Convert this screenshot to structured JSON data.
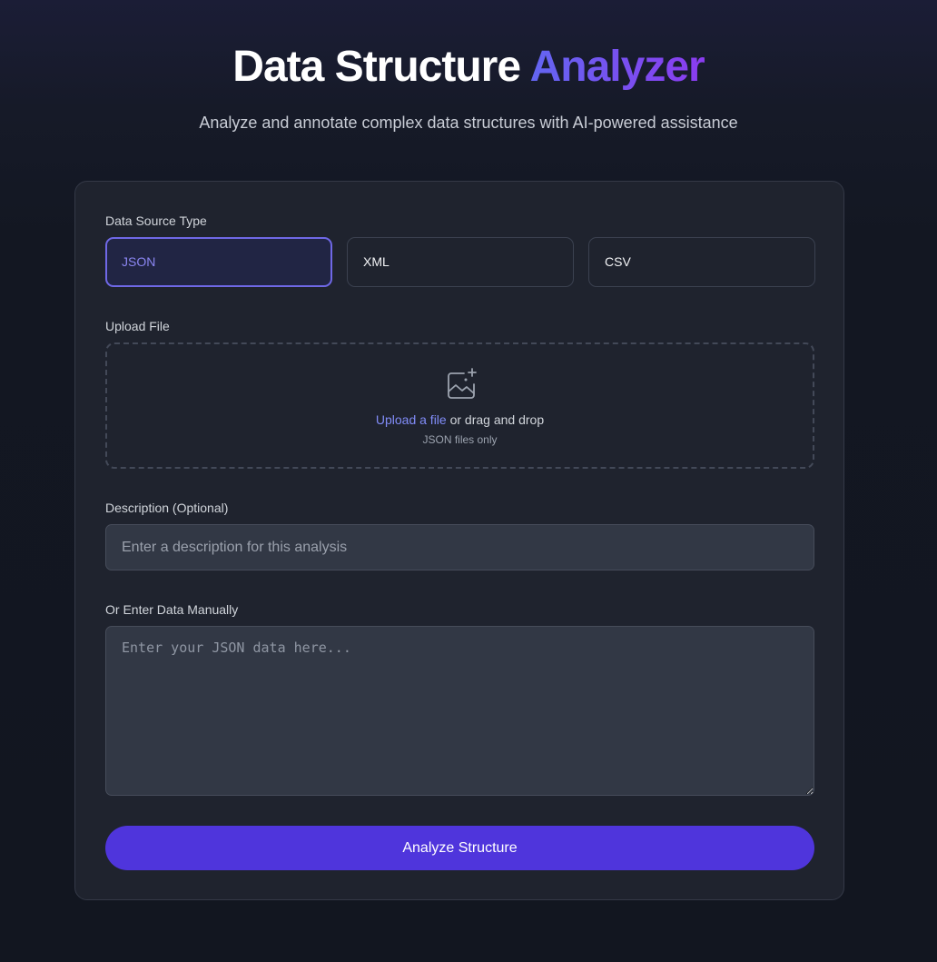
{
  "header": {
    "title_main": "Data Structure ",
    "title_accent": "Analyzer",
    "subtitle": "Analyze and annotate complex data structures with AI-powered assistance"
  },
  "form": {
    "source_type_label": "Data Source Type",
    "source_types": [
      {
        "label": "JSON",
        "selected": true
      },
      {
        "label": "XML",
        "selected": false
      },
      {
        "label": "CSV",
        "selected": false
      }
    ],
    "upload_label": "Upload File",
    "upload_icon": "image-plus-icon",
    "upload_link": "Upload a file",
    "upload_rest": " or drag and drop",
    "upload_hint": "JSON files only",
    "description_label": "Description (Optional)",
    "description_value": "",
    "description_placeholder": "Enter a description for this analysis",
    "manual_label": "Or Enter Data Manually",
    "manual_value": "",
    "manual_placeholder": "Enter your JSON data here...",
    "submit_label": "Analyze Structure"
  },
  "colors": {
    "accent": "#6366f1",
    "accent_end": "#8b3cf0",
    "button": "#4f35dc",
    "link": "#818cf8"
  }
}
